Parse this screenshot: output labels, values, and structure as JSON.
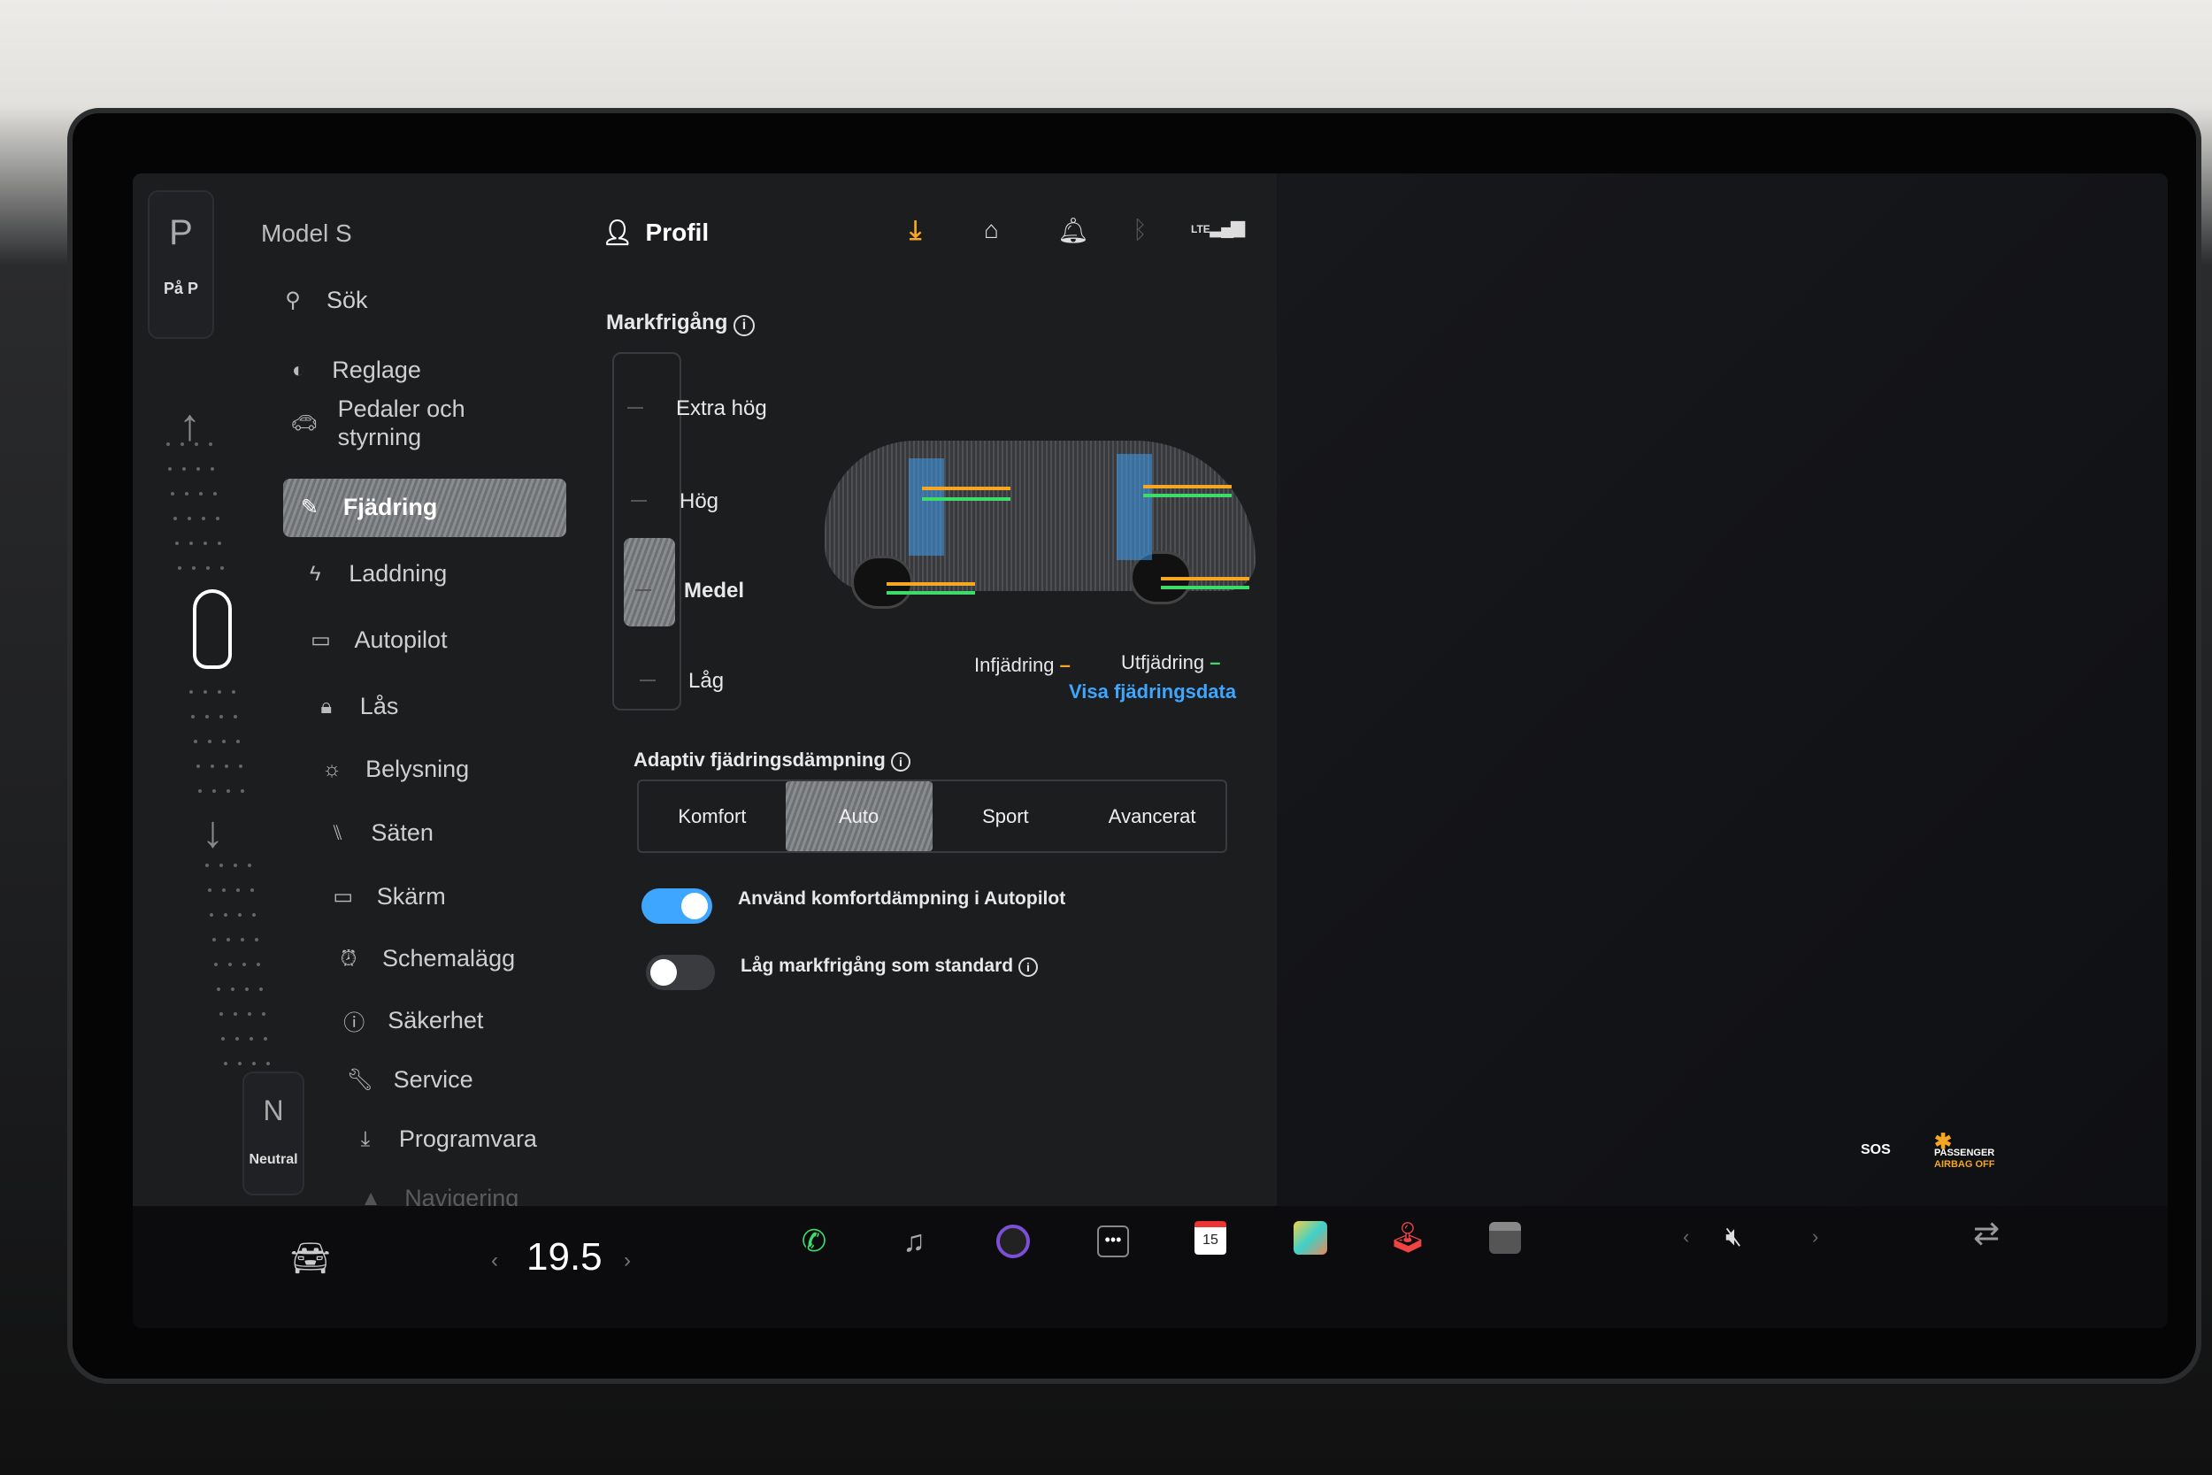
{
  "gear": {
    "park": "P",
    "park_sub": "På P",
    "neutral": "N",
    "neutral_sub": "Neutral"
  },
  "sidebar": {
    "title": "Model S",
    "items": [
      {
        "label": "Sök",
        "icon": "search-icon"
      },
      {
        "label": "Reglage",
        "icon": "toggle-icon"
      },
      {
        "label": "Pedaler och styrning",
        "icon": "car-icon"
      },
      {
        "label": "Fjädring",
        "icon": "suspension-icon",
        "active": true
      },
      {
        "label": "Laddning",
        "icon": "bolt-icon"
      },
      {
        "label": "Autopilot",
        "icon": "steering-icon"
      },
      {
        "label": "Lås",
        "icon": "lock-icon"
      },
      {
        "label": "Belysning",
        "icon": "light-icon"
      },
      {
        "label": "Säten",
        "icon": "seat-icon"
      },
      {
        "label": "Skärm",
        "icon": "display-icon"
      },
      {
        "label": "Schemalägg",
        "icon": "alarm-icon"
      },
      {
        "label": "Säkerhet",
        "icon": "alert-icon"
      },
      {
        "label": "Service",
        "icon": "wrench-icon"
      },
      {
        "label": "Programvara",
        "icon": "download-icon"
      },
      {
        "label": "Navigering",
        "icon": "navigation-icon"
      }
    ]
  },
  "header": {
    "profile": "Profil",
    "lte": "LTE",
    "download_color": "#f5a623"
  },
  "clearance": {
    "title": "Markfrigång",
    "levels": [
      "Extra hög",
      "Hög",
      "Medel",
      "Låg"
    ],
    "selected": "Medel"
  },
  "legend": {
    "compression": "Infjädring",
    "rebound": "Utfjädring",
    "compression_color": "#f5a623",
    "rebound_color": "#3ddc6a",
    "link": "Visa fjädringsdata"
  },
  "damping": {
    "title": "Adaptiv fjädringsdämpning",
    "options": [
      "Komfort",
      "Auto",
      "Sport",
      "Avancerat"
    ],
    "selected": "Auto"
  },
  "toggles": [
    {
      "label": "Använd komfortdämpning i Autopilot",
      "on": true
    },
    {
      "label": "Låg markfrigång som standard",
      "on": false
    }
  ],
  "bottom": {
    "temperature": "19.5",
    "calendar_day": "15",
    "status_sos": "SOS",
    "airbag": "PASSENGER",
    "airbag_status": "AIRBAG OFF",
    "accent": "#3ea6ff"
  }
}
